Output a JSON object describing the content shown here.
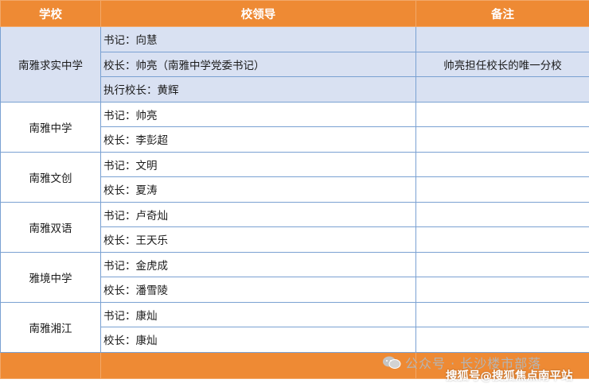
{
  "headers": {
    "school": "学校",
    "leaders": "校领导",
    "notes": "备注"
  },
  "groups": [
    {
      "school": "南雅求实中学",
      "rows": [
        {
          "leader": "书记：向慧",
          "note": ""
        },
        {
          "leader": "校长：帅亮（南雅中学党委书记）",
          "note": "帅亮担任校长的唯一分校"
        },
        {
          "leader": "执行校长：黄辉",
          "note": ""
        }
      ]
    },
    {
      "school": "南雅中学",
      "rows": [
        {
          "leader": "书记：帅亮",
          "note": ""
        },
        {
          "leader": "校长：李彭超",
          "note": ""
        }
      ]
    },
    {
      "school": "南雅文创",
      "rows": [
        {
          "leader": "书记：文明",
          "note": ""
        },
        {
          "leader": "校长：夏涛",
          "note": ""
        }
      ]
    },
    {
      "school": "南雅双语",
      "rows": [
        {
          "leader": "书记：卢奇灿",
          "note": ""
        },
        {
          "leader": "校长：王天乐",
          "note": ""
        }
      ]
    },
    {
      "school": "雅境中学",
      "rows": [
        {
          "leader": "书记：金虎成",
          "note": ""
        },
        {
          "leader": "校长：潘雪陵",
          "note": ""
        }
      ]
    },
    {
      "school": "南雅湘江",
      "rows": [
        {
          "leader": "书记：康灿",
          "note": ""
        },
        {
          "leader": "校长：康灿",
          "note": ""
        }
      ]
    }
  ],
  "watermarks": {
    "wechat_account": "公众号 · 长沙楼市部落",
    "sohu": "搜狐号@搜狐焦点南平站"
  },
  "colors": {
    "header_bg": "#ee8a34",
    "highlight_row_bg": "#d9e1f2",
    "border": "#7aa1d2"
  },
  "icons": {
    "wechat": "wechat-icon"
  }
}
